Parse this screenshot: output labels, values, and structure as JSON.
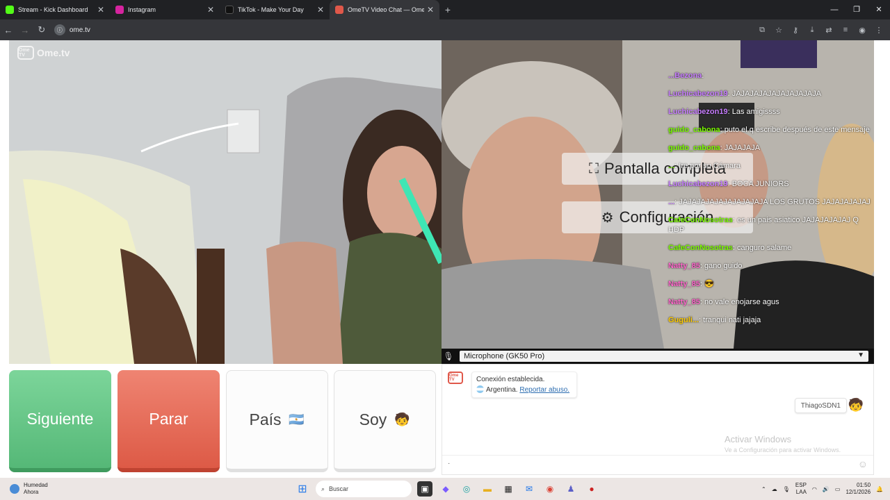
{
  "browser": {
    "tabs": [
      {
        "title": "Stream - Kick Dashboard",
        "favicon_color": "#53fc18",
        "active": false
      },
      {
        "title": "Instagram",
        "favicon_color": "#d6249f",
        "active": false
      },
      {
        "title": "TikTok - Make Your Day",
        "favicon_color": "#111111",
        "active": false
      },
      {
        "title": "OmeTV Video Chat — Ome",
        "favicon_color": "#e0584a",
        "active": true
      }
    ],
    "url": "ome.tv"
  },
  "video": {
    "logo_text": "Ome.tv",
    "logo_badge": "Ome TV",
    "menu": {
      "fullscreen": "Pantalla completa",
      "settings": "Configuración"
    },
    "chat": [
      {
        "user": "...Bezona",
        "text": "",
        "color": "#c77dff"
      },
      {
        "user": "Luchicabezon19",
        "text": "JAJAJAJAJAJAJAJAJAJA",
        "color": "#c77dff"
      },
      {
        "user": "Luchicabezon19",
        "text": "Las amigissss",
        "color": "#c77dff"
      },
      {
        "user": "guido_cabona",
        "text": "puto el q escribe después de este mensaje",
        "color": "#7cfc00"
      },
      {
        "user": "guido_cabona",
        "text": "JAJAJAJA",
        "color": "#7cfc00"
      },
      {
        "user": "...",
        "text": "Ire por su Cámara",
        "color": "#7cfc00"
      },
      {
        "user": "Luchicabezon19",
        "text": "BOCA JUNIORS",
        "color": "#c77dff"
      },
      {
        "user": "...",
        "text": "JAJAJAJAJAJAJAJAJAJA LOS GRUTOS JAJAJAJAJAJ",
        "color": "#c77dff"
      },
      {
        "user": "CafeConNosotras",
        "text": "es un pais asiatico JAJAJAJAJAJ Q HDP",
        "color": "#7cfc00"
      },
      {
        "user": "CafeConNosotras",
        "text": "canguro salame",
        "color": "#7cfc00"
      },
      {
        "user": "Natty_85",
        "text": "gano guido",
        "color": "#ff66cc"
      },
      {
        "user": "Natty_85",
        "text": "😎",
        "color": "#ff66cc"
      },
      {
        "user": "Natty_85",
        "text": "no vale enojarse agus",
        "color": "#ff66cc"
      },
      {
        "user": "Guguli...",
        "text": "tranqui nati jajaja",
        "color": "#ffcc00"
      }
    ],
    "microphone": "Microphone (GK50 Pro)"
  },
  "buttons": {
    "next": "Siguiente",
    "stop": "Parar",
    "country": "País",
    "country_flag": "🇦🇷",
    "soy": "Soy",
    "soy_avatar": "🧒"
  },
  "chatbox": {
    "logo": "Ome TV",
    "status": "Conexión establecida.",
    "country": "Argentina.",
    "report": "Reportar abuso.",
    "user_tag": "ThiagoSDN1",
    "user_avatar": "🧒",
    "watermark_title": "Activar Windows",
    "watermark_sub": "Ve a Configuración para activar Windows.",
    "input_text": "·"
  },
  "taskbar": {
    "weather_title": "Humedad",
    "weather_sub": "Ahora",
    "search": "Buscar",
    "lang1": "ESP",
    "lang2": "LAA",
    "time": "01:50",
    "date": "12/1/2026"
  }
}
